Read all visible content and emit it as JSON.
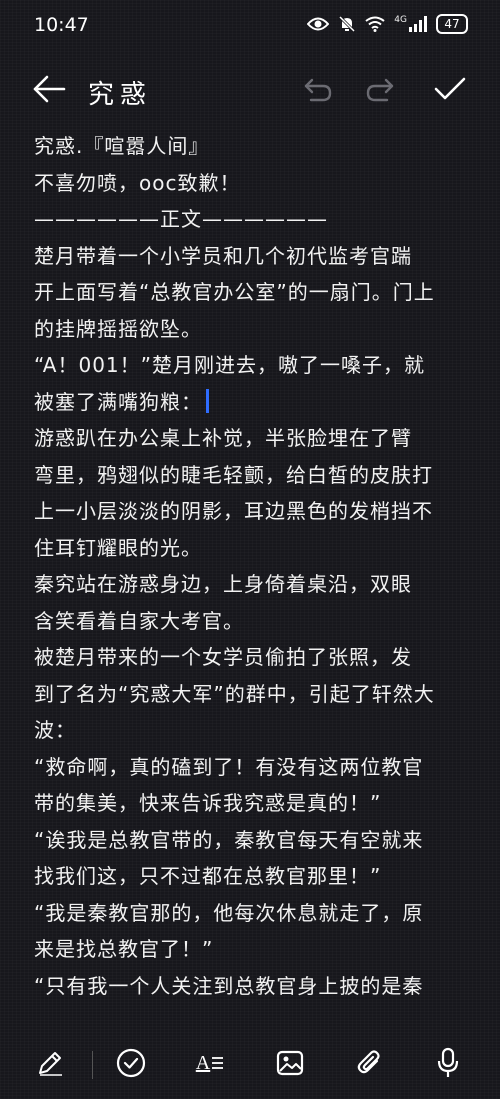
{
  "status_bar": {
    "time": "10:47",
    "network": "4G",
    "battery": "47"
  },
  "header": {
    "title": "究惑",
    "back_icon": "arrow-left-icon",
    "undo_icon": "undo-icon",
    "redo_icon": "redo-icon",
    "confirm_icon": "check-icon"
  },
  "note": {
    "lines": [
      "究惑.『喧嚣人间』",
      "不喜勿喷，ooc致歉！",
      "——————正文——————",
      "  楚月带着一个小学员和几个初代监考官踹",
      "开上面写着“总教官办公室”的一扇门。门上",
      "的挂牌摇摇欲坠。",
      "  “A！001！”楚月刚进去，嗷了一嗓子，就",
      "被塞了满嘴狗粮：",
      "  游惑趴在办公桌上补觉，半张脸埋在了臂",
      "弯里，鸦翅似的睫毛轻颤，给白皙的皮肤打",
      "上一小层淡淡的阴影，耳边黑色的发梢挡不",
      "住耳钉耀眼的光。",
      "  秦究站在游惑身边，上身倚着桌沿，双眼",
      "含笑看着自家大考官。",
      "  被楚月带来的一个女学员偷拍了张照，发",
      "到了名为“究惑大军”的群中，引起了轩然大",
      "波：",
      "  “救命啊，真的磕到了！有没有这两位教官",
      "带的集美，快来告诉我究惑是真的！”",
      "  “诶我是总教官带的，秦教官每天有空就来",
      "找我们这，只不过都在总教官那里！”",
      "  “我是秦教官那的，他每次休息就走了，原",
      "来是找总教官了！”",
      "  “只有我一个人关注到总教官身上披的是秦"
    ]
  },
  "toolbar": {
    "items": [
      "pen-icon",
      "checklist-icon",
      "text-format-icon",
      "image-icon",
      "attachment-icon",
      "microphone-icon"
    ],
    "text_format_label": "A"
  }
}
